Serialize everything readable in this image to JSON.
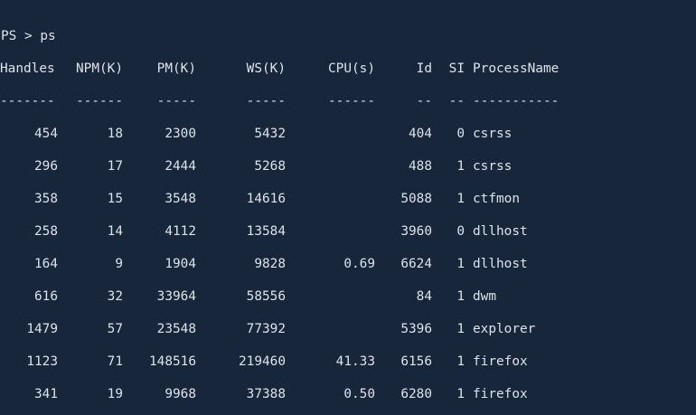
{
  "terminal": {
    "prompt": "PS > ps"
  },
  "table": {
    "headers": [
      "Handles",
      "NPM(K)",
      "PM(K)",
      "WS(K)",
      "CPU(s)",
      "Id",
      "SI",
      "ProcessName"
    ],
    "separators": [
      "-------",
      "------",
      "-----",
      "-----",
      "------",
      "--",
      "--",
      "-----------"
    ],
    "rows": [
      [
        "454",
        "18",
        "2300",
        "5432",
        "",
        "404",
        "0",
        "csrss"
      ],
      [
        "296",
        "17",
        "2444",
        "5268",
        "",
        "488",
        "1",
        "csrss"
      ],
      [
        "358",
        "15",
        "3548",
        "14616",
        "",
        "5088",
        "1",
        "ctfmon"
      ],
      [
        "258",
        "14",
        "4112",
        "13584",
        "",
        "3960",
        "0",
        "dllhost"
      ],
      [
        "164",
        "9",
        "1904",
        "9828",
        "0.69",
        "6624",
        "1",
        "dllhost"
      ],
      [
        "616",
        "32",
        "33964",
        "58556",
        "",
        "84",
        "1",
        "dwm"
      ],
      [
        "1479",
        "57",
        "23548",
        "77392",
        "",
        "5396",
        "1",
        "explorer"
      ],
      [
        "1123",
        "71",
        "148516",
        "219460",
        "41.33",
        "6156",
        "1",
        "firefox"
      ],
      [
        "341",
        "19",
        "9968",
        "37388",
        "0.50",
        "6280",
        "1",
        "firefox"
      ]
    ]
  },
  "colors": {
    "background": "#17263a",
    "foreground": "#dde3ea"
  }
}
